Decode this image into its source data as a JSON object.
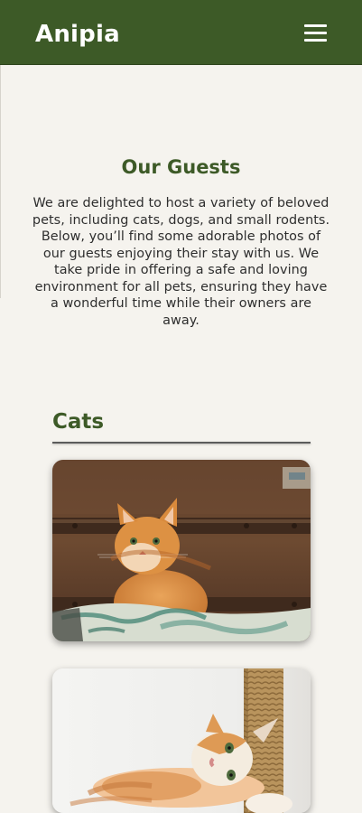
{
  "header": {
    "logo": "Anipia",
    "menu_icon": "hamburger-menu-icon",
    "background_color": "#3d5a27"
  },
  "intro": {
    "title": "Our Guests",
    "text": "We are delighted to host a variety of beloved pets, including cats, dogs, and small rodents. Below, you’ll find some adorable photos of our guests enjoying their stay with us. We take pride in offering a safe and loving environment for all pets, ensuring they have a wonderful time while their owners are away."
  },
  "sections": [
    {
      "title": "Cats",
      "photos": [
        {
          "subject": "orange tabby cat sitting on a patterned cushion in front of a wooden wall"
        },
        {
          "subject": "orange and white kitten lying on its side next to a scratching post"
        }
      ]
    }
  ],
  "colors": {
    "page_background": "#f5f3ee",
    "accent_green": "#3d5a27",
    "text": "#2e2e2e"
  }
}
